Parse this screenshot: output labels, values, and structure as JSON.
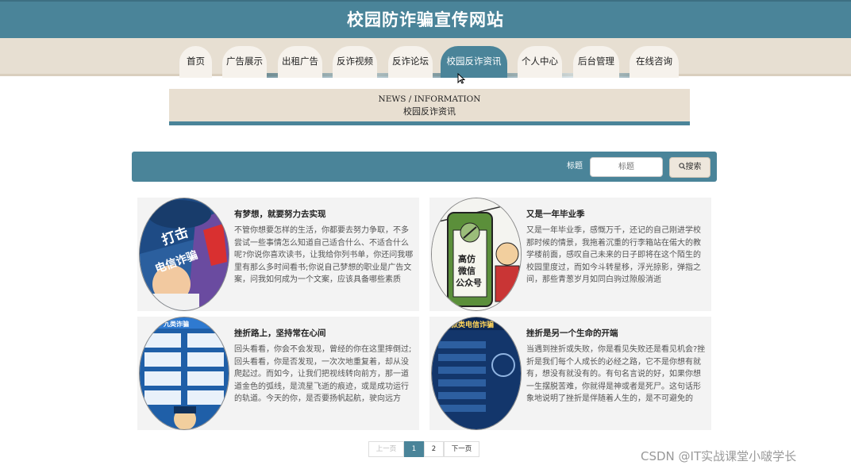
{
  "header": {
    "title": "校园防诈骗宣传网站"
  },
  "nav": {
    "items": [
      "首页",
      "广告展示",
      "出租广告",
      "反诈视频",
      "反诈论坛",
      "校园反诈资讯",
      "个人中心",
      "后台管理",
      "在线咨询"
    ],
    "active_index": 5
  },
  "banner": {
    "en": "NEWS / INFORMATION",
    "cn": "校园反诈资讯"
  },
  "search": {
    "label": "标题",
    "placeholder": "标题",
    "button": "搜索"
  },
  "articles": [
    {
      "title": "有梦想，就要努力去实现",
      "excerpt": "不管你想要怎样的生活，你都要去努力争取，不多尝试一些事情怎么知道自己适合什么、不适合什么呢?你说你喜欢读书，让我给你列书单，你还问我哪里有那么多时间看书;你说自己梦想的职业是广告文案，问我如何成为一个文案，应该具备哪些素质",
      "image_text": [
        "打击",
        "电信诈骗"
      ]
    },
    {
      "title": "又是一年毕业季",
      "excerpt": "又是一年毕业季，感慨万千，还记的自己刚进学校那时候的情景，我拖着沉重的行李箱站在偌大的教学楼前面，感叹自己未来的日子即将在这个陌生的校园里度过，而如今斗转星移，浮光掠影，弹指之间，那些青葱岁月如同白驹过隙般消逝",
      "image_text": [
        "高仿",
        "微信",
        "公众号"
      ]
    },
    {
      "title": "挫折路上，坚持常在心间",
      "excerpt": "回头看看，你会不会发现，曾经的你在这里摔倒过;回头看看，你是否发现，一次次地重复着，却从没爬起过。而如今，让我们把视线转向前方，那一道道金色的弧线，是流星飞逝的痕迹，或是成功运行的轨道。今天的你，是否要扬帆起航，驶向远方",
      "image_text": [
        "九类诈骗"
      ]
    },
    {
      "title": "挫折是另一个生命的开端",
      "excerpt": "当遇到挫折或失败，你是看见失败还是看见机会?挫折是我们每个人成长的必经之路，它不是你想有就有，想没有就没有的。有句名言说的好，如果你想一生摆脱苦难，你就得是神或者是死尸。这句话形象地说明了挫折是伴随着人生的，是不可避免的",
      "image_text": [
        "网贷款类电信诈骗"
      ]
    }
  ],
  "pagination": {
    "prev": "上一页",
    "pages": [
      "1",
      "2"
    ],
    "current": "1",
    "next": "下一页"
  },
  "watermark": "CSDN @IT实战课堂小啵学长",
  "colors": {
    "primary": "#4a8499",
    "nav_bg": "#e7dfd2",
    "banner_bg": "#e8dfd1",
    "card_bg": "#f3f3f3"
  }
}
